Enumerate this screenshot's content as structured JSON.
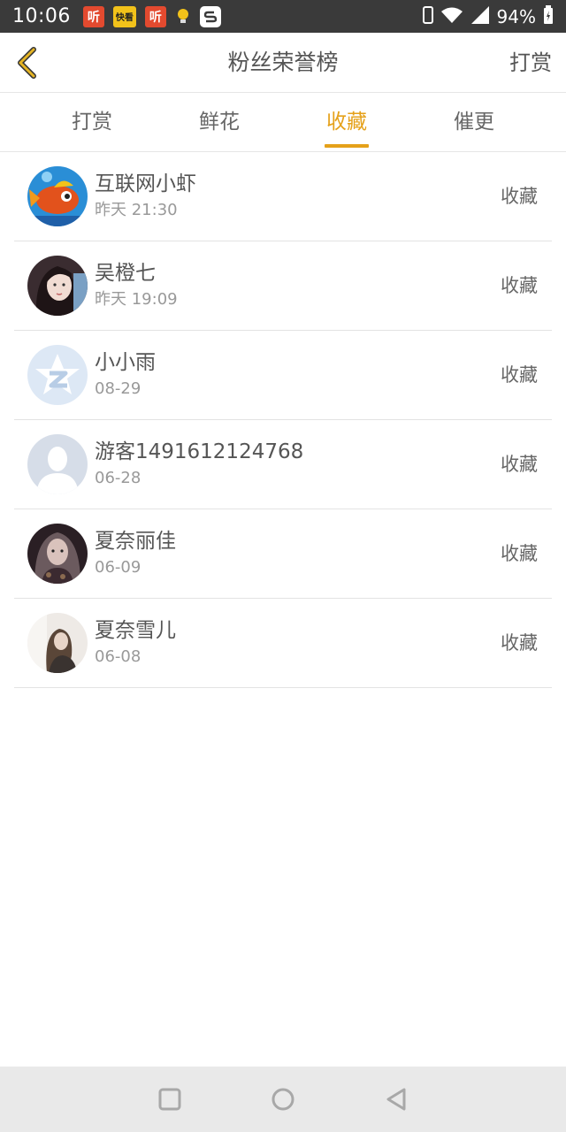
{
  "status_bar": {
    "time": "10:06",
    "notif_icons": [
      "听",
      "快看",
      "听"
    ],
    "battery": "94%"
  },
  "header": {
    "title": "粉丝荣誉榜",
    "action": "打赏"
  },
  "tabs": [
    {
      "label": "打赏",
      "active": false
    },
    {
      "label": "鲜花",
      "active": false
    },
    {
      "label": "收藏",
      "active": true
    },
    {
      "label": "催更",
      "active": false
    }
  ],
  "list": [
    {
      "name": "互联网小虾",
      "time": "昨天 21:30",
      "action": "收藏",
      "avatar": "fish-avatar-icon"
    },
    {
      "name": "吴橙七",
      "time": "昨天 19:09",
      "action": "收藏",
      "avatar": "girl-portrait-avatar"
    },
    {
      "name": "小小雨",
      "time": "08-29",
      "action": "收藏",
      "avatar": "qq-star-avatar-icon"
    },
    {
      "name": "游客1491612124768",
      "time": "06-28",
      "action": "收藏",
      "avatar": "default-person-avatar-icon"
    },
    {
      "name": "夏奈丽佳",
      "time": "06-09",
      "action": "收藏",
      "avatar": "dark-portrait-avatar"
    },
    {
      "name": "夏奈雪儿",
      "time": "06-08",
      "action": "收藏",
      "avatar": "light-portrait-avatar"
    }
  ],
  "colors": {
    "accent": "#e5a11a",
    "status_bar": "#3a3a3a",
    "nav_bar": "#e9e9e9",
    "divider": "#e3e3e3"
  }
}
